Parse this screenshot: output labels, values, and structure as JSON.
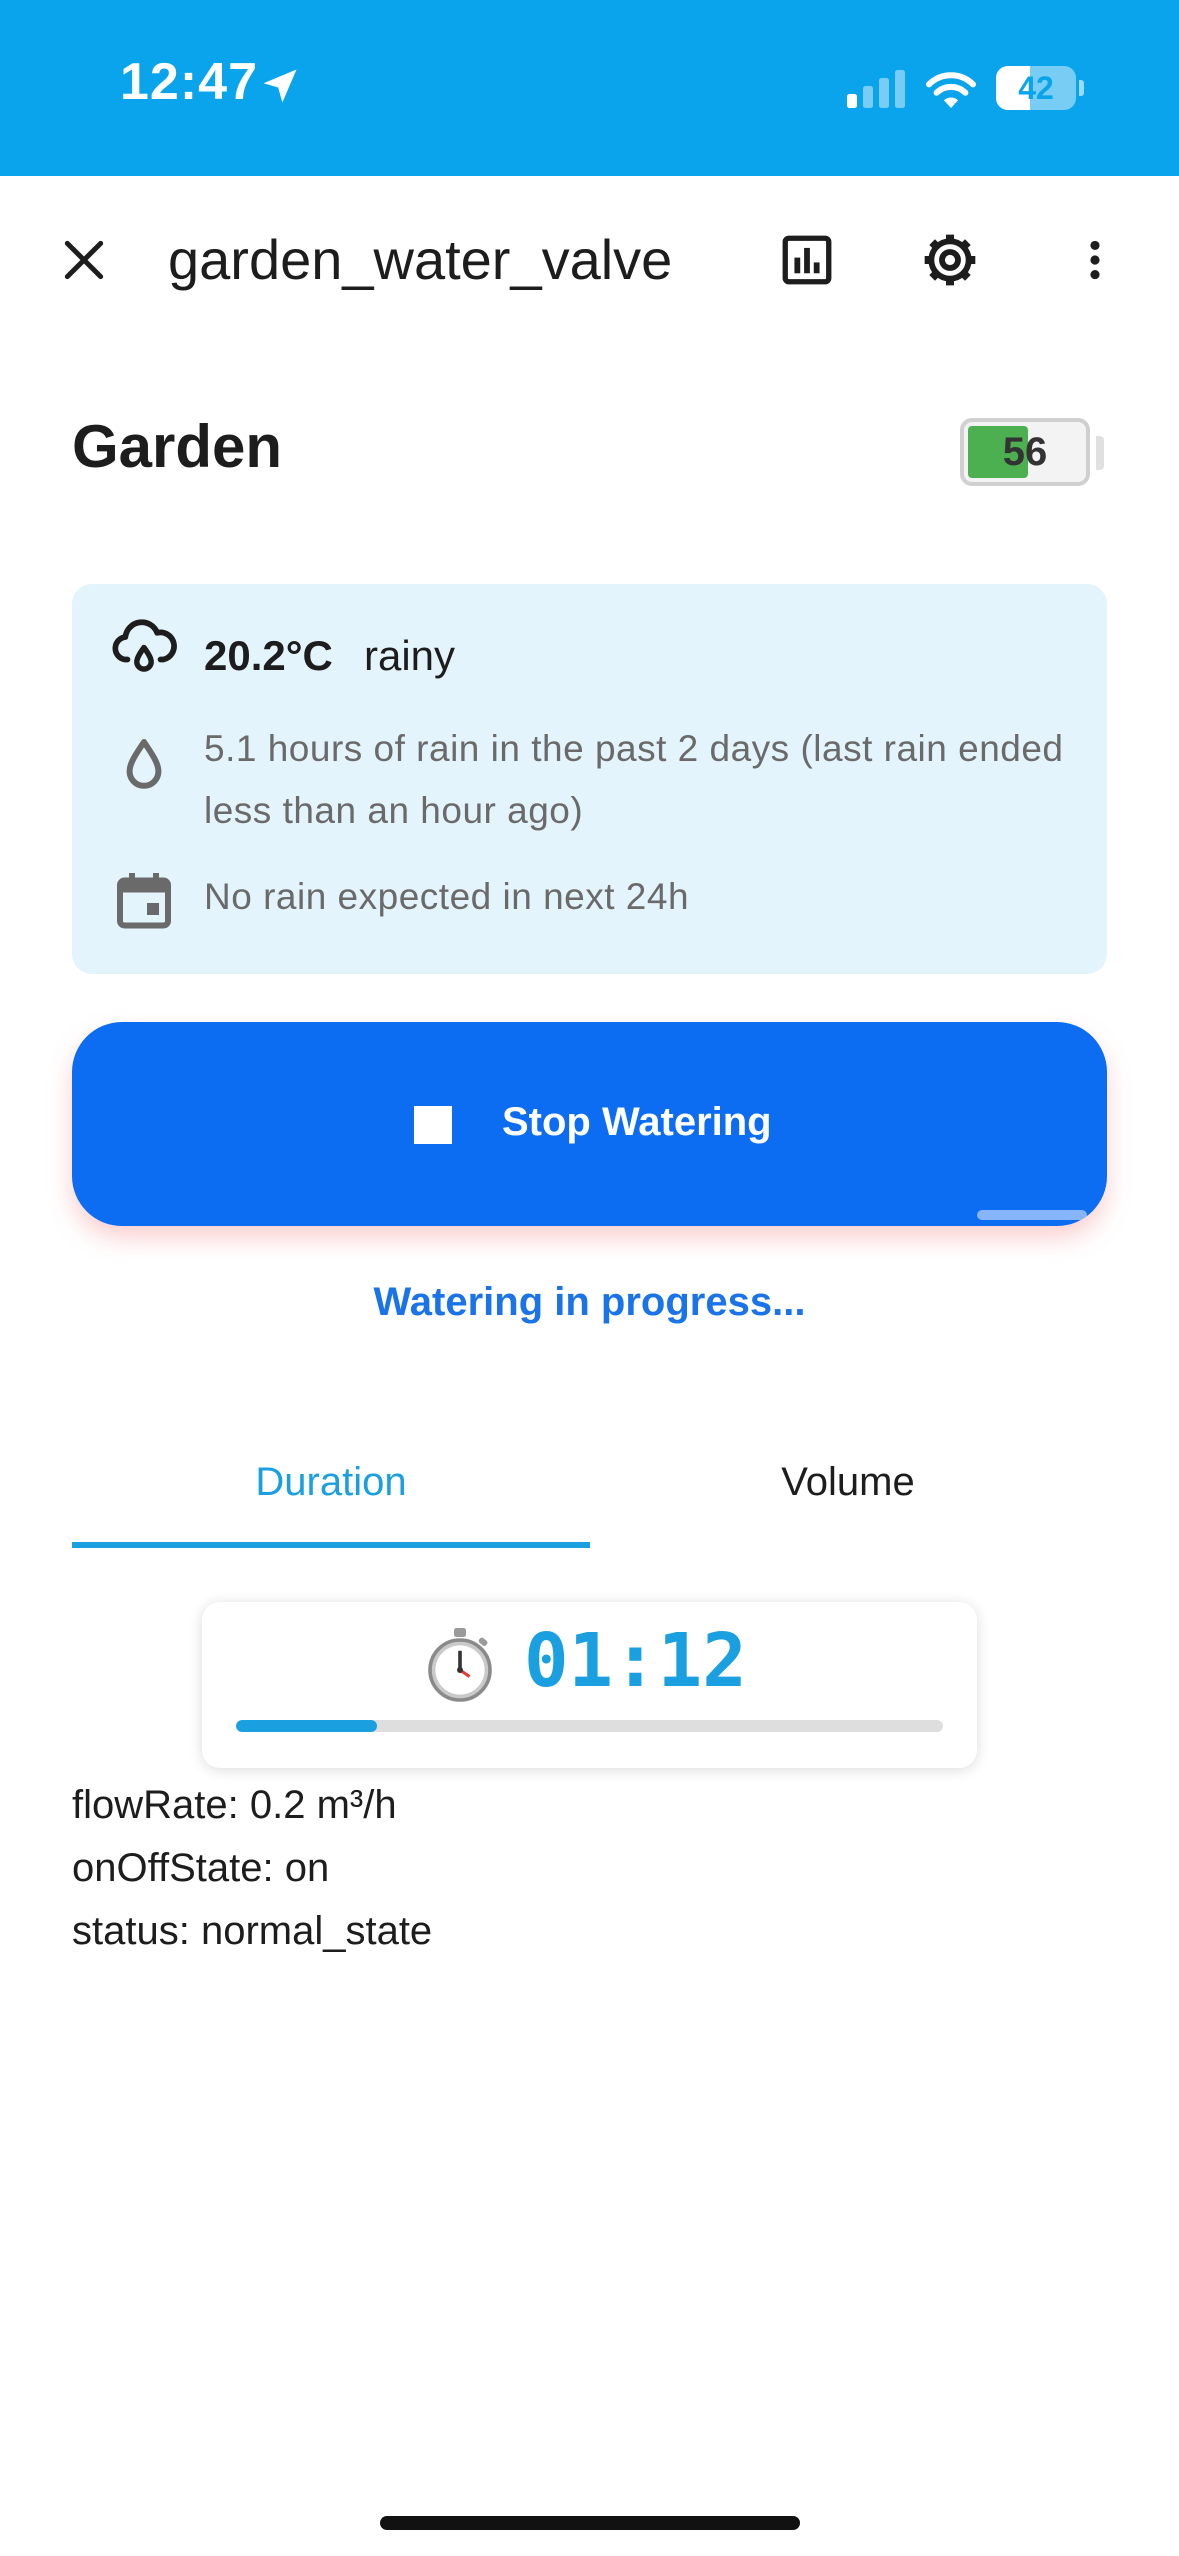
{
  "status_bar": {
    "time": "12:47",
    "battery_level": "42",
    "battery_fraction": 0.42,
    "background_color": "#0aa4ec",
    "icons": [
      "location-arrow-icon",
      "cellular-signal-icon",
      "wifi-icon",
      "battery-icon"
    ]
  },
  "app_bar": {
    "title": "garden_water_valve",
    "icons": [
      "close-icon",
      "chart-icon",
      "gear-icon",
      "more-vertical-icon"
    ]
  },
  "device": {
    "name": "Garden",
    "battery_level": "56",
    "battery_fraction": 0.56,
    "battery_color": "#4caf50"
  },
  "weather": {
    "temperature": "20.2°C",
    "condition": "rainy",
    "rain_history": "5.1 hours of rain in the past 2 days (last rain ended less than an hour ago)",
    "forecast": "No rain expected in next 24h",
    "icons": [
      "cloud-rain-icon",
      "water-drop-icon",
      "calendar-icon"
    ],
    "background_color": "#e3f4fc"
  },
  "action": {
    "button_label": "Stop Watering",
    "button_icon": "stop-icon",
    "button_color": "#0c6cf2",
    "status_text": "Watering in progress..."
  },
  "tabs": [
    {
      "label": "Duration",
      "selected": true
    },
    {
      "label": "Volume",
      "selected": false
    }
  ],
  "timer": {
    "icon": "stopwatch-icon",
    "value": "01:12",
    "progress_fraction": 0.2,
    "accent_color": "#1a9fe0"
  },
  "attributes": [
    "flowRate: 0.2 m³/h",
    "onOffState: on",
    "status: normal_state"
  ]
}
